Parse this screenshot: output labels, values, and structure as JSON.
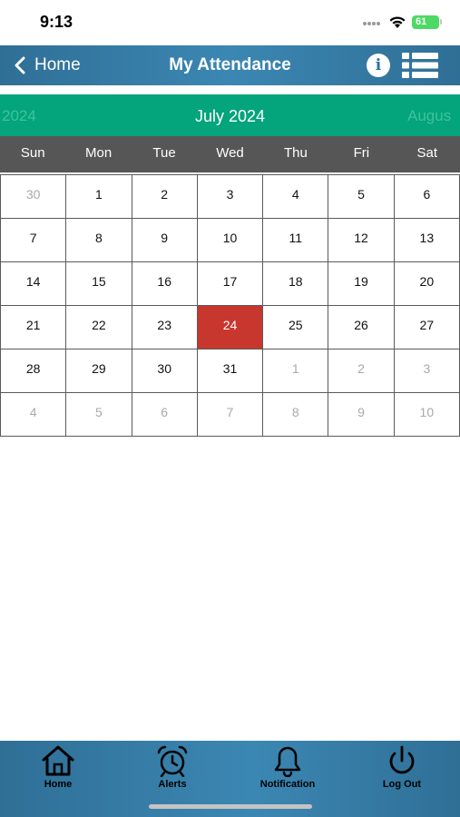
{
  "status_bar": {
    "time": "9:13",
    "battery": "61"
  },
  "nav": {
    "back_label": "Home",
    "title": "My Attendance",
    "info_icon": "info-icon",
    "menu_icon": "list-icon"
  },
  "month_strip": {
    "prev": "2024",
    "current": "July 2024",
    "next": "Augus"
  },
  "weekdays": [
    "Sun",
    "Mon",
    "Tue",
    "Wed",
    "Thu",
    "Fri",
    "Sat"
  ],
  "calendar": {
    "days": [
      {
        "label": "30",
        "muted": true
      },
      {
        "label": "1"
      },
      {
        "label": "2"
      },
      {
        "label": "3"
      },
      {
        "label": "4"
      },
      {
        "label": "5"
      },
      {
        "label": "6"
      },
      {
        "label": "7"
      },
      {
        "label": "8"
      },
      {
        "label": "9"
      },
      {
        "label": "10"
      },
      {
        "label": "11"
      },
      {
        "label": "12"
      },
      {
        "label": "13"
      },
      {
        "label": "14"
      },
      {
        "label": "15"
      },
      {
        "label": "16"
      },
      {
        "label": "17"
      },
      {
        "label": "18"
      },
      {
        "label": "19"
      },
      {
        "label": "20"
      },
      {
        "label": "21"
      },
      {
        "label": "22"
      },
      {
        "label": "23"
      },
      {
        "label": "24",
        "today": true
      },
      {
        "label": "25"
      },
      {
        "label": "26"
      },
      {
        "label": "27"
      },
      {
        "label": "28"
      },
      {
        "label": "29"
      },
      {
        "label": "30"
      },
      {
        "label": "31"
      },
      {
        "label": "1",
        "muted": true
      },
      {
        "label": "2",
        "muted": true
      },
      {
        "label": "3",
        "muted": true
      },
      {
        "label": "4",
        "muted": true
      },
      {
        "label": "5",
        "muted": true
      },
      {
        "label": "6",
        "muted": true
      },
      {
        "label": "7",
        "muted": true
      },
      {
        "label": "8",
        "muted": true
      },
      {
        "label": "9",
        "muted": true
      },
      {
        "label": "10",
        "muted": true
      }
    ],
    "highlight_color": "#c8372d"
  },
  "tabs": {
    "home": "Home",
    "alerts": "Alerts",
    "notification": "Notification",
    "logout": "Log Out"
  },
  "colors": {
    "nav_bar": "#3b87b3",
    "month_strip": "#04a47c",
    "weekday_header": "#565656"
  }
}
